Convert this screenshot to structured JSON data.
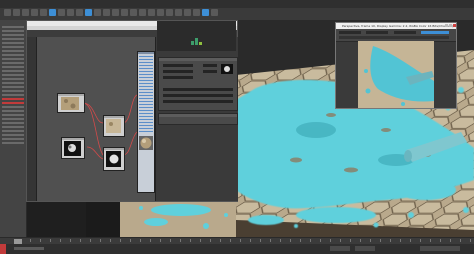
{
  "colors": {
    "accent_blue": "#3d8fd6",
    "water_cyan": "#5fd0dc",
    "wire_red": "#d24a4a",
    "tile_stone": "#b9a98c",
    "ui_dark": "#2d2d2d"
  },
  "main_toolbar": {
    "icons": [
      "undo-icon",
      "redo-icon",
      "link-icon",
      "unlink-icon",
      "bind-icon",
      "select-icon",
      "select-by-name-icon",
      "rect-select-icon",
      "window-crossing-icon",
      "move-icon",
      "rotate-icon",
      "scale-icon",
      "snap-icon",
      "angle-snap-icon",
      "percent-snap-icon",
      "mirror-icon",
      "align-icon",
      "layer-icon",
      "curve-editor-icon",
      "schematic-icon",
      "material-editor-icon",
      "render-setup-icon",
      "render-icon",
      "render-frame-icon"
    ]
  },
  "slate_editor": {
    "title": "",
    "nodes": [
      {
        "kind": "map",
        "thumb": "stone"
      },
      {
        "kind": "map",
        "thumb": "noise-dark"
      },
      {
        "kind": "material",
        "thumb": "stone"
      },
      {
        "kind": "map",
        "thumb": "noise-dark"
      },
      {
        "kind": "material",
        "thumb": "sphere"
      }
    ]
  },
  "render_window": {
    "title": "Perspective, frame 10, Display Gamma: 2.2, RGBA Color 16 Bits/Channel (1:1)"
  },
  "status": {
    "left_text": "",
    "frame": ""
  }
}
